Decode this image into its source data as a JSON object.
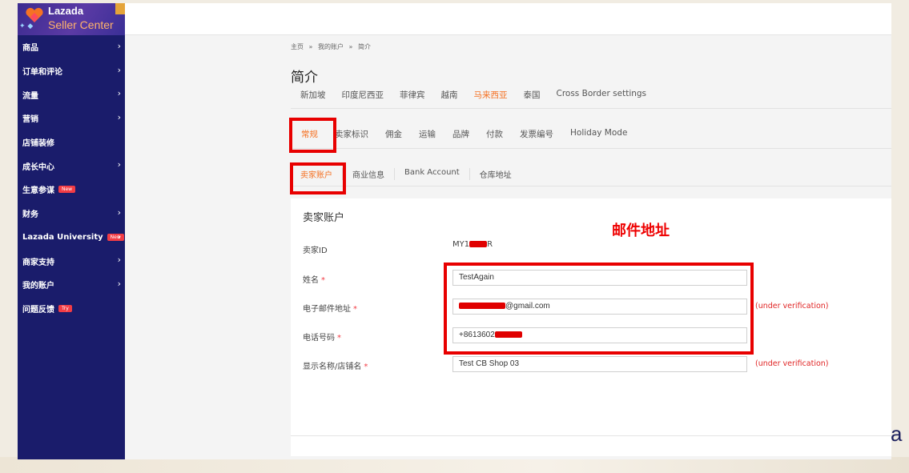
{
  "brand": {
    "name": "Lazada",
    "subtitle": "Seller Center"
  },
  "sidebar": {
    "items": [
      {
        "label": "商品",
        "arrow": "›"
      },
      {
        "label": "订单和评论",
        "arrow": "›"
      },
      {
        "label": "流量",
        "arrow": "›"
      },
      {
        "label": "营销",
        "arrow": "›"
      },
      {
        "label": "店铺装修",
        "arrow": ""
      },
      {
        "label": "成长中心",
        "arrow": "›"
      },
      {
        "label": "生意参谋",
        "arrow": "",
        "badge": "New"
      },
      {
        "label": "财务",
        "arrow": "›"
      },
      {
        "label": "Lazada University",
        "arrow": "›",
        "badge": "New"
      },
      {
        "label": "商家支持",
        "arrow": "›"
      },
      {
        "label": "我的账户",
        "arrow": "›"
      },
      {
        "label": "问题反馈",
        "arrow": "",
        "badge": "Try"
      }
    ]
  },
  "breadcrumb": {
    "home": "主页",
    "sep1": "»",
    "account": "我的账户",
    "sep2": "»",
    "current": "简介"
  },
  "page": {
    "title": "简介"
  },
  "country_tabs": [
    "新加坡",
    "印度尼西亚",
    "菲律宾",
    "越南",
    "马来西亚",
    "泰国",
    "Cross Border settings"
  ],
  "main_tabs": [
    "常规",
    "卖家标识",
    "佣金",
    "运输",
    "品牌",
    "付款",
    "发票编号",
    "Holiday Mode"
  ],
  "sub_tabs": [
    "卖家账户",
    "商业信息",
    "Bank Account",
    "仓库地址"
  ],
  "form": {
    "title": "卖家账户",
    "seller_id_label": "卖家ID",
    "seller_id_prefix": "MY1",
    "seller_id_suffix": "R",
    "name_label": "姓名",
    "name_value": "TestAgain",
    "email_label": "电子邮件地址",
    "email_value": "@gmail.com",
    "phone_label": "电话号码",
    "phone_value": "+8613602",
    "display_label": "显示名称/店铺名",
    "display_value": "Test CB Shop 03",
    "required_mark": "*",
    "verification_note": "(under verification)"
  },
  "annotation": {
    "text": "邮件地址"
  },
  "corner": {
    "letter": "a"
  },
  "colors": {
    "sidebar": "#1a1c6b",
    "accent": "#f57224",
    "annotation": "#e80000"
  }
}
